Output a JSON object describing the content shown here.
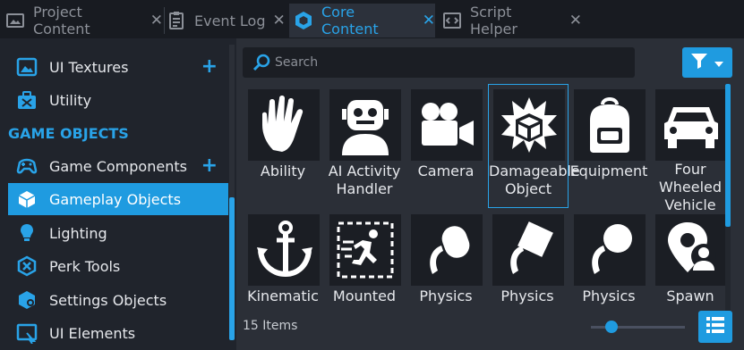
{
  "tabs": [
    {
      "label": "Project Content",
      "icon": "project-content-icon"
    },
    {
      "label": "Event Log",
      "icon": "event-log-icon"
    },
    {
      "label": "Core Content",
      "icon": "core-content-icon",
      "active": true
    },
    {
      "label": "Script Helper",
      "icon": "script-helper-icon"
    }
  ],
  "sidebar": {
    "items_top": [
      {
        "label": "UI Textures",
        "icon": "image-icon",
        "plus": "+"
      },
      {
        "label": "Utility",
        "icon": "toolbox-icon"
      }
    ],
    "section_header": "GAME OBJECTS",
    "items": [
      {
        "label": "Game Components",
        "icon": "gamepad-icon",
        "plus": "+"
      },
      {
        "label": "Gameplay Objects",
        "icon": "cube-icon",
        "active": true
      },
      {
        "label": "Lighting",
        "icon": "bulb-icon"
      },
      {
        "label": "Perk Tools",
        "icon": "perk-icon"
      },
      {
        "label": "Settings Objects",
        "icon": "settings-cube-icon"
      },
      {
        "label": "UI Elements",
        "icon": "ui-elements-icon"
      }
    ]
  },
  "search": {
    "placeholder": "Search"
  },
  "grid": {
    "items": [
      {
        "label": "Ability",
        "icon": "hand-icon"
      },
      {
        "label": "AI Activity Handler",
        "icon": "robot-icon"
      },
      {
        "label": "Camera",
        "icon": "camera-icon"
      },
      {
        "label": "Damageable Object",
        "icon": "damageable-box-icon",
        "selected": true
      },
      {
        "label": "Equipment",
        "icon": "backpack-icon"
      },
      {
        "label": "Four Wheeled Vehicle",
        "icon": "car-icon"
      },
      {
        "label": "Kinematic Anchor",
        "icon": "anchor-icon"
      },
      {
        "label": "Mounted",
        "icon": "runner-icon"
      },
      {
        "label": "Physics",
        "icon": "physics-circle-icon"
      },
      {
        "label": "Physics",
        "icon": "physics-square-icon"
      },
      {
        "label": "Physics",
        "icon": "physics-sphere-icon"
      },
      {
        "label": "Spawn",
        "icon": "spawn-pin-icon"
      }
    ]
  },
  "footer": {
    "count": "15 Items",
    "zoom_fraction": 0.15
  },
  "colors": {
    "accent": "#1f9be0",
    "bg": "#20242c",
    "panel": "#2b2f37"
  }
}
